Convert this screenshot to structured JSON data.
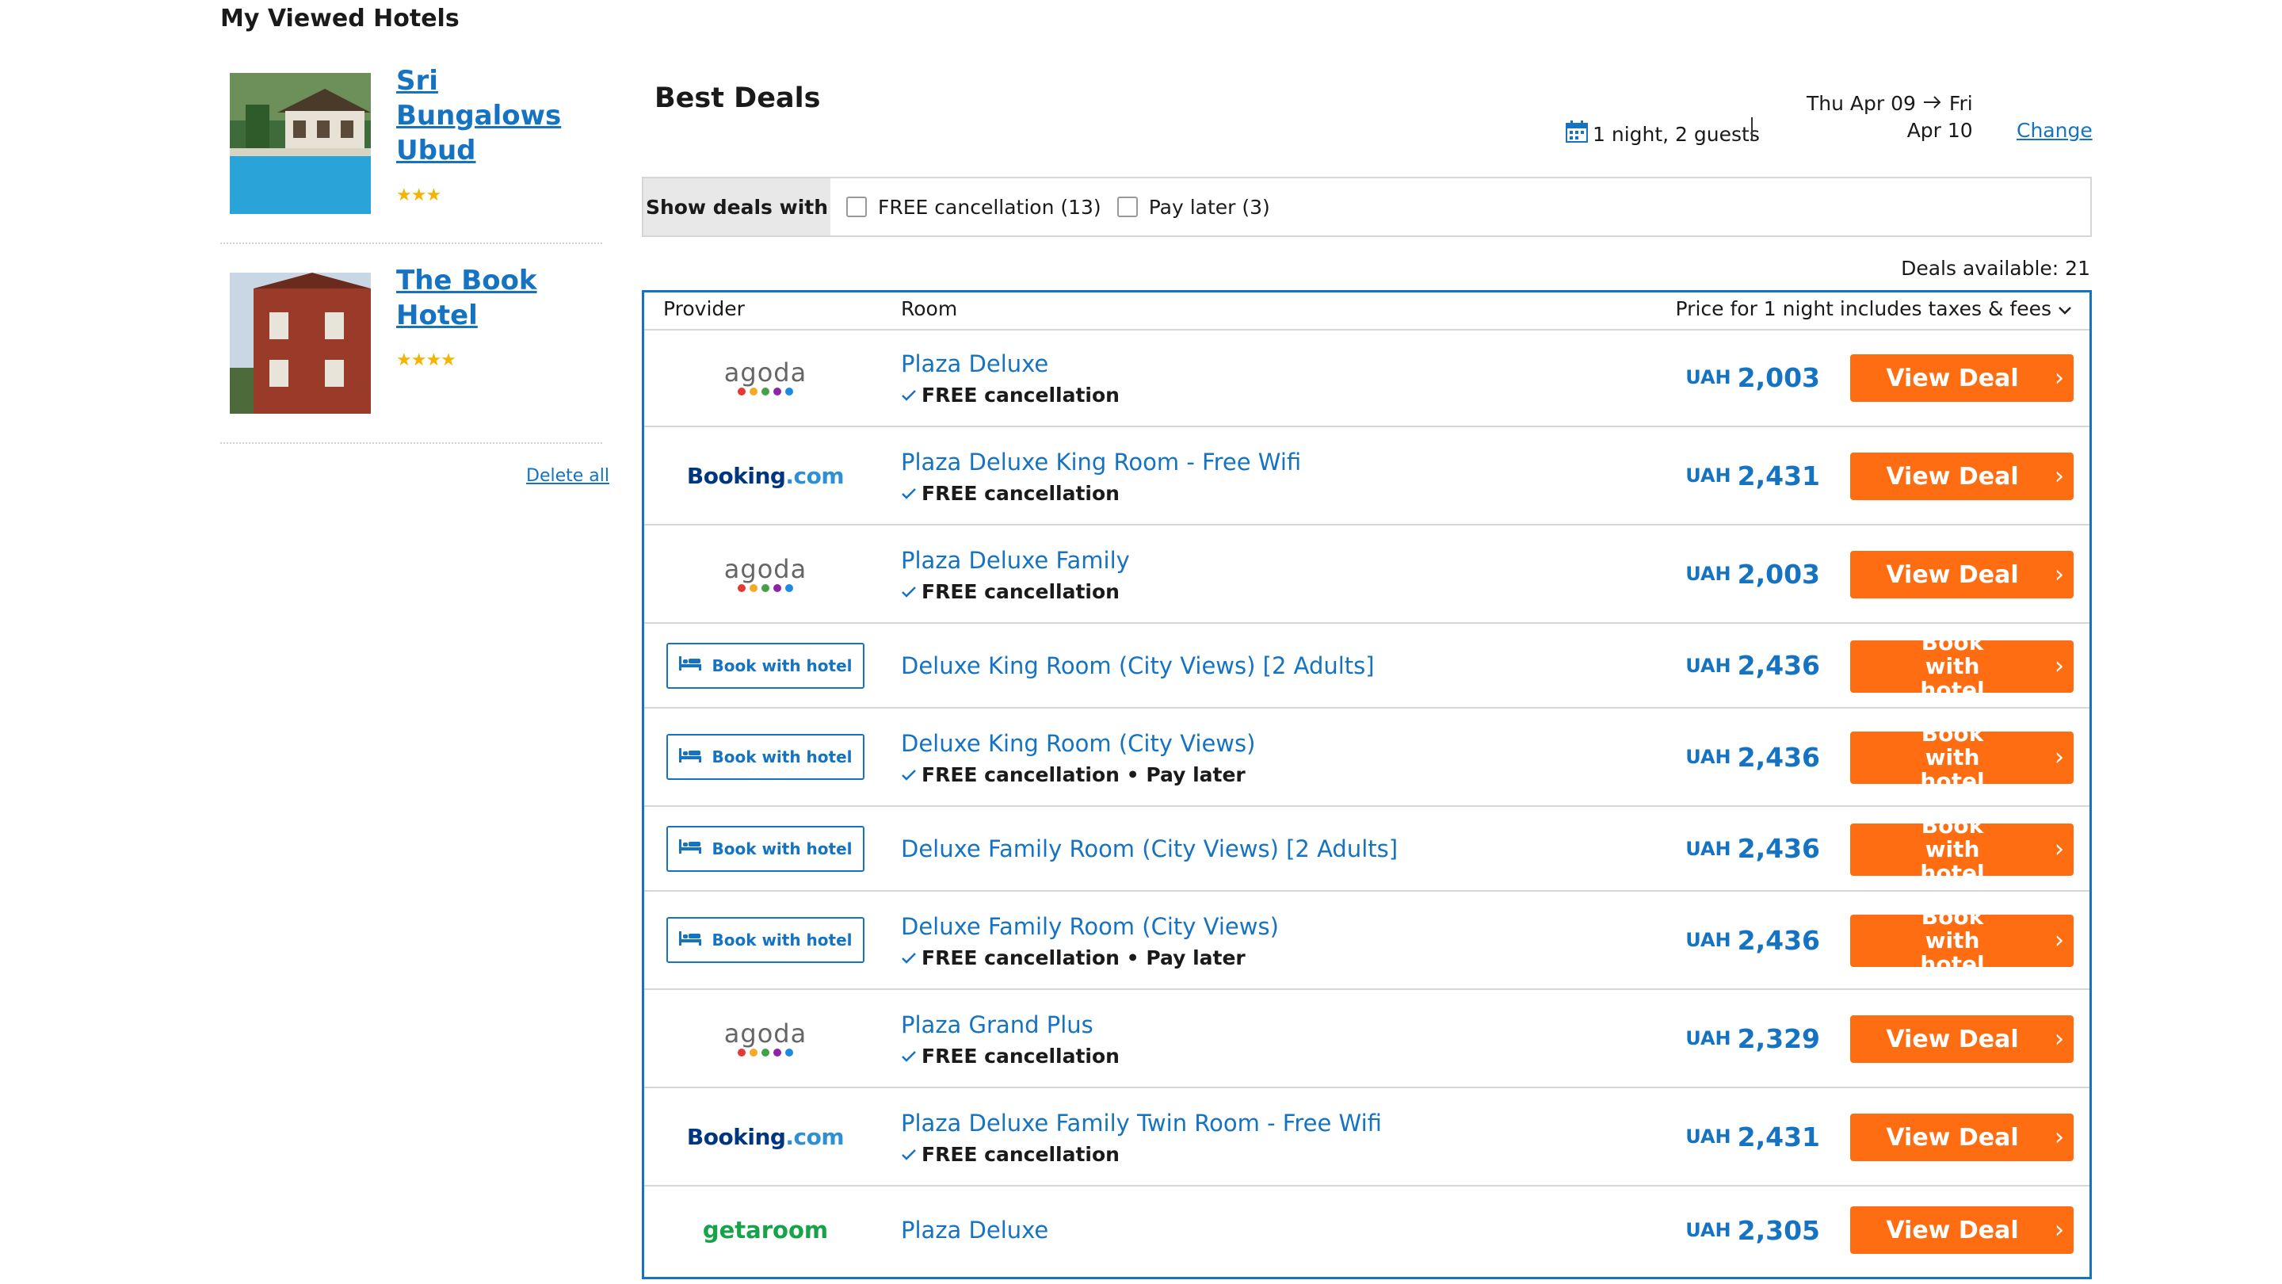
{
  "left": {
    "title": "My Viewed Hotels",
    "hotels": [
      {
        "name": "Sri Bungalows Ubud",
        "stars": "★★★"
      },
      {
        "name": "The Book Hotel",
        "stars": "★★★★"
      }
    ],
    "delete_all": "Delete all"
  },
  "header": {
    "title": "Best Deals",
    "nights_guests": "1 night, 2 guests",
    "date_from": "Thu Apr 09",
    "date_to_day": "Fri",
    "date_to": "Apr 10",
    "change": "Change"
  },
  "filters": {
    "label": "Show deals with",
    "options": [
      {
        "label": "FREE cancellation (13)",
        "checked": false
      },
      {
        "label": "Pay later (3)",
        "checked": false
      }
    ]
  },
  "deals_available": "Deals available: 21",
  "table": {
    "col_provider": "Provider",
    "col_room": "Room",
    "col_price": "Price for 1 night includes taxes & fees",
    "rows": [
      {
        "provider": "agoda",
        "provider_text": "agoda",
        "room": "Plaza Deluxe",
        "perks": "FREE cancellation",
        "currency": "UAH",
        "price": "2,003",
        "button": "View Deal"
      },
      {
        "provider": "booking",
        "provider_text": "Booking",
        "provider_text2": ".com",
        "room": "Plaza Deluxe King Room - Free Wifi",
        "perks": "FREE cancellation",
        "currency": "UAH",
        "price": "2,431",
        "button": "View Deal"
      },
      {
        "provider": "agoda",
        "provider_text": "agoda",
        "room": "Plaza Deluxe Family",
        "perks": "FREE cancellation",
        "currency": "UAH",
        "price": "2,003",
        "button": "View Deal"
      },
      {
        "provider": "hotel",
        "provider_text": "Book with hotel",
        "room": "Deluxe King Room (City Views) [2 Adults]",
        "perks": "",
        "currency": "UAH",
        "price": "2,436",
        "button": "Book with hotel"
      },
      {
        "provider": "hotel",
        "provider_text": "Book with hotel",
        "room": "Deluxe King Room (City Views)",
        "perks": "FREE cancellation • Pay later",
        "currency": "UAH",
        "price": "2,436",
        "button": "Book with hotel"
      },
      {
        "provider": "hotel",
        "provider_text": "Book with hotel",
        "room": "Deluxe Family Room (City Views) [2 Adults]",
        "perks": "",
        "currency": "UAH",
        "price": "2,436",
        "button": "Book with hotel"
      },
      {
        "provider": "hotel",
        "provider_text": "Book with hotel",
        "room": "Deluxe Family Room (City Views)",
        "perks": "FREE cancellation • Pay later",
        "currency": "UAH",
        "price": "2,436",
        "button": "Book with hotel"
      },
      {
        "provider": "agoda",
        "provider_text": "agoda",
        "room": "Plaza Grand Plus",
        "perks": "FREE cancellation",
        "currency": "UAH",
        "price": "2,329",
        "button": "View Deal"
      },
      {
        "provider": "booking",
        "provider_text": "Booking",
        "provider_text2": ".com",
        "room": "Plaza Deluxe Family Twin Room - Free Wifi",
        "perks": "FREE cancellation",
        "currency": "UAH",
        "price": "2,431",
        "button": "View Deal"
      },
      {
        "provider": "getaroom",
        "provider_text": "getaroom",
        "room": "Plaza Deluxe",
        "perks": "",
        "currency": "UAH",
        "price": "2,305",
        "button": "View Deal"
      }
    ]
  },
  "colors": {
    "accent_blue": "#1573c2",
    "button_orange": "#ff6d12",
    "star_gold": "#f5b400",
    "agoda_dots": [
      "#e53935",
      "#f9a825",
      "#43a047",
      "#8e24aa",
      "#1e88e5"
    ]
  }
}
